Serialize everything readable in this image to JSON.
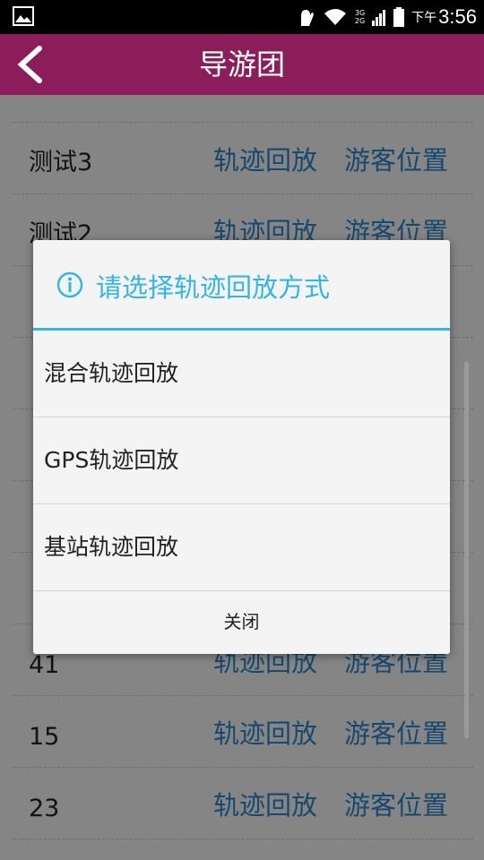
{
  "status_bar": {
    "network_top": "3G",
    "network_bottom": "2G",
    "time_prefix": "下午",
    "time": "3:56"
  },
  "header": {
    "title": "导游团"
  },
  "list": {
    "rows": [
      {
        "name": "测试3",
        "action1": "轨迹回放",
        "action2": "游客位置"
      },
      {
        "name": "测试2",
        "action1": "轨迹回放",
        "action2": "游客位置"
      },
      {
        "name": "",
        "action1": "",
        "action2": ""
      },
      {
        "name": "",
        "action1": "",
        "action2": ""
      },
      {
        "name": "",
        "action1": "",
        "action2": ""
      },
      {
        "name": "",
        "action1": "",
        "action2": ""
      },
      {
        "name": "",
        "action1": "",
        "action2": ""
      },
      {
        "name": "41",
        "action1": "轨迹回放",
        "action2": "游客位置"
      },
      {
        "name": "15",
        "action1": "轨迹回放",
        "action2": "游客位置"
      },
      {
        "name": "23",
        "action1": "轨迹回放",
        "action2": "游客位置"
      }
    ]
  },
  "dialog": {
    "title": "请选择轨迹回放方式",
    "options": [
      "混合轨迹回放",
      "GPS轨迹回放",
      "基站轨迹回放"
    ],
    "close_label": "关闭",
    "accent_color": "#33b5e5"
  },
  "colors": {
    "header_bg": "#8a1d5a",
    "link": "#2a86c8"
  }
}
